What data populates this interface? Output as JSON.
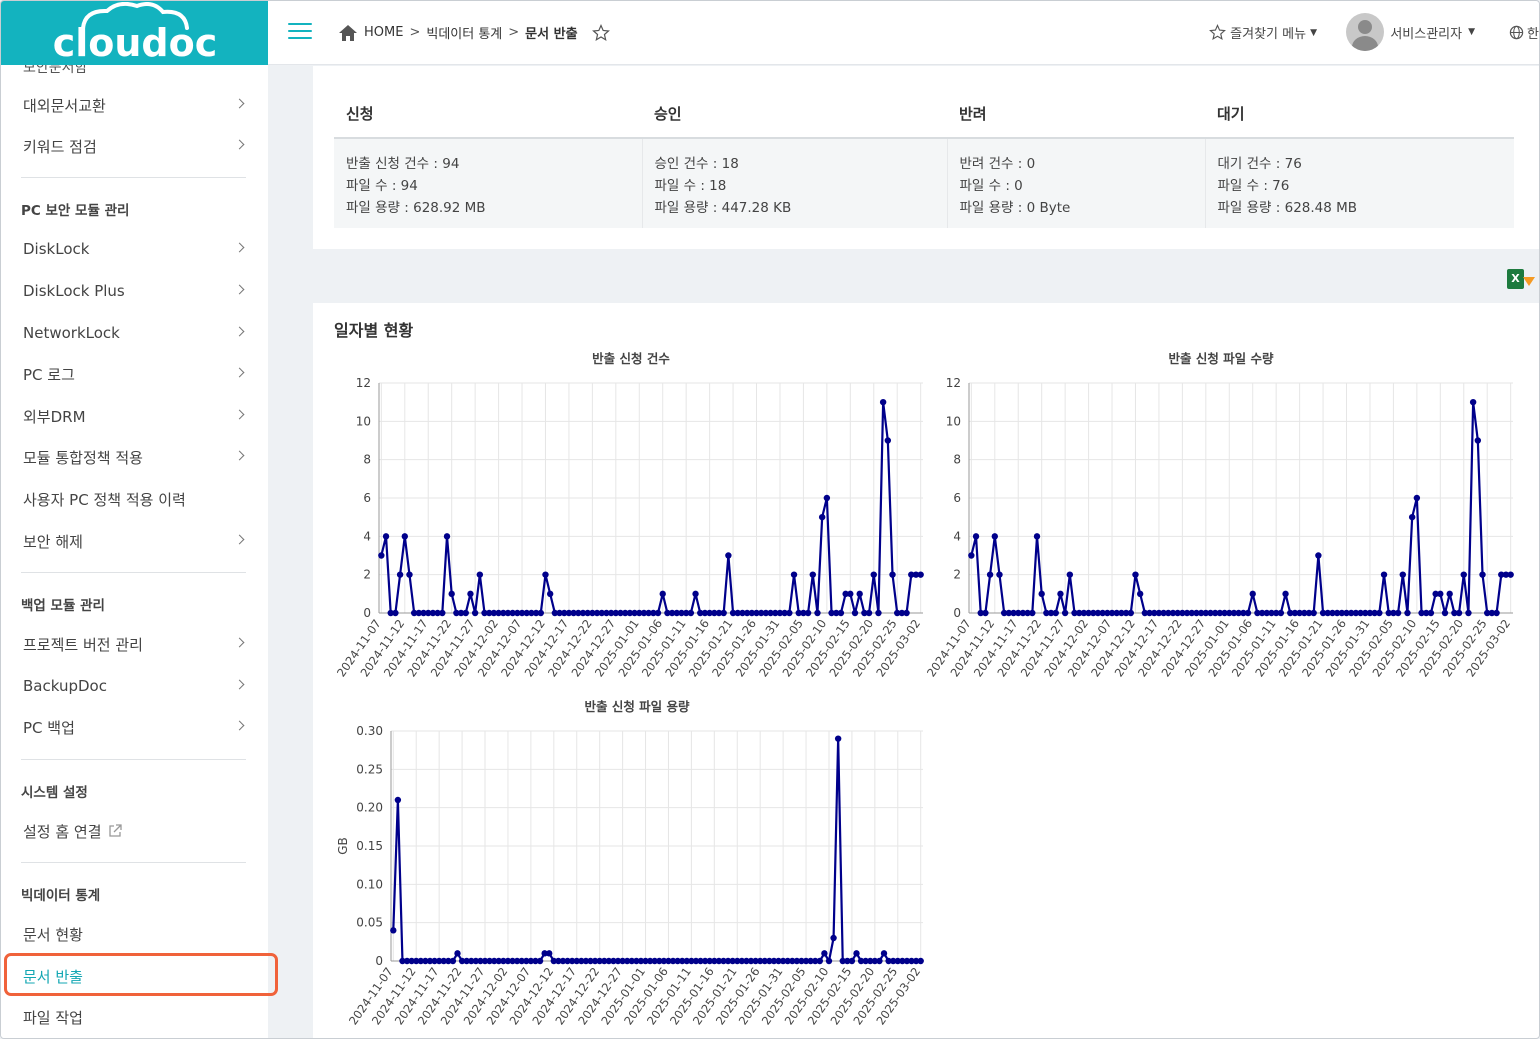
{
  "brand": {
    "logo_text": "cloudoc"
  },
  "breadcrumb": {
    "home": "HOME",
    "sep": ">",
    "parent": "빅데이터 통계",
    "current": "문서 반출"
  },
  "header": {
    "favorites": "즐겨찾기 메뉴",
    "user": "서비스관리자",
    "lang": "한"
  },
  "colors": {
    "brand": "#13b3bf",
    "line": "#00008b",
    "highlight": "#f0623a"
  },
  "sidebar": {
    "cut_item": "보안문서함",
    "items_a": [
      "대외문서교환",
      "키워드 점검"
    ],
    "header_pc": "PC 보안 모듈 관리",
    "items_pc": [
      "DiskLock",
      "DiskLock Plus",
      "NetworkLock",
      "PC 로그",
      "외부DRM",
      "모듈 통합정책 적용",
      "사용자 PC 정책 적용 이력",
      "보안 해제"
    ],
    "header_backup": "백업 모듈 관리",
    "items_backup": [
      "프로젝트 버전 관리",
      "BackupDoc",
      "PC 백업"
    ],
    "header_system": "시스템 설정",
    "system_link": "설정 홈 연결",
    "header_bigdata": "빅데이터 통계",
    "items_bigdata": [
      "문서 현황",
      "문서 반출",
      "파일 작업"
    ]
  },
  "summary": {
    "columns": [
      "신청",
      "승인",
      "반려",
      "대기"
    ],
    "cells": [
      [
        "반출 신청 건수 : 94",
        "파일 수 : 94",
        "파일 용량 : 628.92 MB"
      ],
      [
        "승인 건수 : 18",
        "파일 수 : 18",
        "파일 용량 : 447.28 KB"
      ],
      [
        "반려 건수 : 0",
        "파일 수 : 0",
        "파일 용량 : 0 Byte"
      ],
      [
        "대기 건수 : 76",
        "파일 수 : 76",
        "파일 용량 : 628.48 MB"
      ]
    ]
  },
  "daily_title": "일자별 현황",
  "excel_icon_label": "X",
  "chart_data": [
    {
      "type": "line",
      "title": "반출 신청 건수",
      "ylabel": "",
      "ylim": [
        0,
        12
      ],
      "yticks": [
        0,
        2,
        4,
        6,
        8,
        10,
        12
      ],
      "x_start": "2024-11-07",
      "x_end": "2025-03-02",
      "x_label_step": 5,
      "values": [
        3,
        4,
        0,
        0,
        2,
        4,
        2,
        0,
        0,
        0,
        0,
        0,
        0,
        0,
        4,
        1,
        0,
        0,
        0,
        1,
        0,
        2,
        0,
        0,
        0,
        0,
        0,
        0,
        0,
        0,
        0,
        0,
        0,
        0,
        0,
        2,
        1,
        0,
        0,
        0,
        0,
        0,
        0,
        0,
        0,
        0,
        0,
        0,
        0,
        0,
        0,
        0,
        0,
        0,
        0,
        0,
        0,
        0,
        0,
        0,
        1,
        0,
        0,
        0,
        0,
        0,
        0,
        1,
        0,
        0,
        0,
        0,
        0,
        0,
        3,
        0,
        0,
        0,
        0,
        0,
        0,
        0,
        0,
        0,
        0,
        0,
        0,
        0,
        2,
        0,
        0,
        0,
        2,
        0,
        5,
        6,
        0,
        0,
        0,
        1,
        1,
        0,
        1,
        0,
        0,
        2,
        0,
        11,
        9,
        2,
        0,
        0,
        0,
        2,
        2,
        2
      ]
    },
    {
      "type": "line",
      "title": "반출 신청 파일 수량",
      "ylabel": "",
      "ylim": [
        0,
        12
      ],
      "yticks": [
        0,
        2,
        4,
        6,
        8,
        10,
        12
      ],
      "x_start": "2024-11-07",
      "x_end": "2025-03-02",
      "x_label_step": 5,
      "values": [
        3,
        4,
        0,
        0,
        2,
        4,
        2,
        0,
        0,
        0,
        0,
        0,
        0,
        0,
        4,
        1,
        0,
        0,
        0,
        1,
        0,
        2,
        0,
        0,
        0,
        0,
        0,
        0,
        0,
        0,
        0,
        0,
        0,
        0,
        0,
        2,
        1,
        0,
        0,
        0,
        0,
        0,
        0,
        0,
        0,
        0,
        0,
        0,
        0,
        0,
        0,
        0,
        0,
        0,
        0,
        0,
        0,
        0,
        0,
        0,
        1,
        0,
        0,
        0,
        0,
        0,
        0,
        1,
        0,
        0,
        0,
        0,
        0,
        0,
        3,
        0,
        0,
        0,
        0,
        0,
        0,
        0,
        0,
        0,
        0,
        0,
        0,
        0,
        2,
        0,
        0,
        0,
        2,
        0,
        5,
        6,
        0,
        0,
        0,
        1,
        1,
        0,
        1,
        0,
        0,
        2,
        0,
        11,
        9,
        2,
        0,
        0,
        0,
        2,
        2,
        2
      ]
    },
    {
      "type": "line",
      "title": "반출 신청 파일 용량",
      "ylabel": "GB",
      "ylim": [
        0,
        0.3
      ],
      "yticks": [
        "0",
        "0.05",
        "0.10",
        "0.15",
        "0.20",
        "0.25",
        "0.30"
      ],
      "x_start": "2024-11-07",
      "x_end": "2025-03-02",
      "x_label_step": 5,
      "values": [
        0.04,
        0.21,
        0,
        0,
        0,
        0,
        0,
        0,
        0,
        0,
        0,
        0,
        0,
        0,
        0.01,
        0,
        0,
        0,
        0,
        0,
        0,
        0,
        0,
        0,
        0,
        0,
        0,
        0,
        0,
        0,
        0,
        0,
        0,
        0.01,
        0.01,
        0,
        0,
        0,
        0,
        0,
        0,
        0,
        0,
        0,
        0,
        0,
        0,
        0,
        0,
        0,
        0,
        0,
        0,
        0,
        0,
        0,
        0,
        0,
        0,
        0,
        0,
        0,
        0,
        0,
        0,
        0,
        0,
        0,
        0,
        0,
        0,
        0,
        0,
        0,
        0,
        0,
        0,
        0,
        0,
        0,
        0,
        0,
        0,
        0,
        0,
        0,
        0,
        0,
        0,
        0,
        0,
        0,
        0,
        0,
        0.01,
        0,
        0.03,
        0.29,
        0,
        0,
        0,
        0.01,
        0,
        0,
        0,
        0,
        0,
        0.01,
        0,
        0,
        0,
        0,
        0,
        0,
        0,
        0
      ]
    }
  ]
}
